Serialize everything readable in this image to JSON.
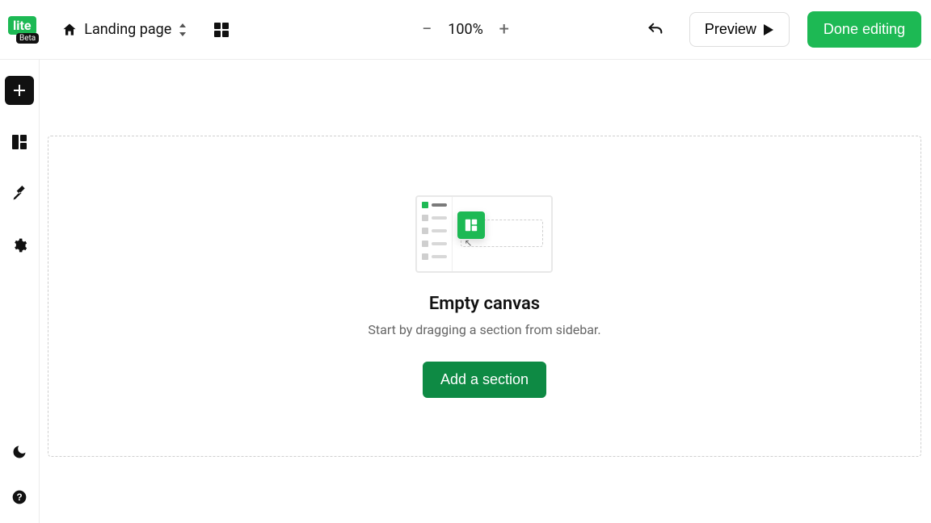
{
  "logo": {
    "text": "lite",
    "sub": "Beta"
  },
  "header": {
    "page_name": "Landing page",
    "zoom": "100%",
    "preview_label": "Preview",
    "done_label": "Done editing"
  },
  "empty": {
    "title": "Empty canvas",
    "description": "Start by dragging a section from sidebar.",
    "cta": "Add a section"
  }
}
